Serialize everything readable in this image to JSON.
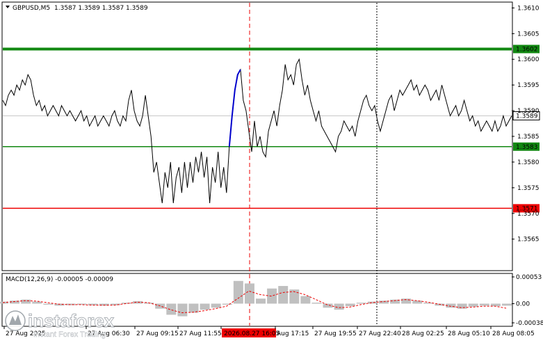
{
  "header": {
    "symbol": "GBPUSD,M5",
    "ohlc": "1.3587 1.3589 1.3587 1.3589"
  },
  "colors": {
    "price_line": "#000000",
    "highlight_line": "#0000cc",
    "level_green_thick": "#118811",
    "level_green": "#118811",
    "level_red": "#ee0000",
    "marker_red": "#ee0000",
    "macd_hist": "#c0c0c0",
    "macd_signal": "#ee0000",
    "tag_green": "#118811",
    "tag_red": "#ee0000",
    "tag_current_bg": "#ffffff"
  },
  "price_axis": {
    "ticks": [
      "1.3610",
      "1.3605",
      "1.3600",
      "1.3595",
      "1.3590",
      "1.3585",
      "1.3580",
      "1.3575",
      "1.3570",
      "1.3565"
    ]
  },
  "levels": [
    {
      "price": 1.3602,
      "label": "1.3602",
      "style": "thick-green"
    },
    {
      "price": 1.3583,
      "label": "1.3583",
      "style": "green"
    },
    {
      "price": 1.3571,
      "label": "1.3571",
      "style": "red"
    }
  ],
  "current_price": {
    "price": 1.3589,
    "label": "1.3589"
  },
  "macd": {
    "title": "MACD(12,26,9) -0.00005 -0.00009",
    "ticks": [
      "0.00053",
      "0.00",
      "-0.00038"
    ],
    "range": [
      -0.00038,
      0.00053
    ]
  },
  "time_axis": {
    "labels": [
      "27 Aug 2025",
      "27 Aug 06:30",
      "27 Aug 09:15",
      "27 Aug 11:55",
      "2026.08.27 16:05",
      "Aug 17:15",
      "27 Aug 19:55",
      "27 Aug 22:40",
      "28 Aug 02:25",
      "28 Aug 05:10",
      "28 Aug 08:05"
    ],
    "highlight_index": 4
  },
  "watermark": {
    "brand": "instaforex",
    "tagline": "Instant Forex Trading"
  },
  "chart_data": {
    "type": "line",
    "title": "GBPUSD,M5",
    "ylim": [
      1.3559,
      1.3611
    ],
    "series": [
      {
        "name": "GBPUSD,M5",
        "x": [
          0,
          1,
          2,
          3,
          4,
          5,
          6,
          7,
          8,
          9,
          10,
          11,
          12,
          13,
          14,
          15,
          16,
          17,
          18,
          19,
          20,
          21,
          22,
          23,
          24,
          25,
          26,
          27,
          28,
          29,
          30,
          31,
          32,
          33,
          34,
          35,
          36,
          37,
          38,
          39,
          40,
          41,
          42,
          43,
          44,
          45,
          46,
          47,
          48,
          49,
          50,
          51,
          52,
          53,
          54,
          55,
          56,
          57,
          58,
          59,
          60,
          61,
          62,
          63,
          64,
          65,
          66,
          67,
          68,
          69,
          70,
          71,
          72,
          73,
          74,
          75,
          76,
          77,
          78,
          79,
          80,
          81,
          82,
          83,
          84,
          85,
          86,
          87,
          88,
          89,
          90,
          91,
          92,
          93,
          94,
          95,
          96,
          97,
          98,
          99,
          100,
          101,
          102,
          103,
          104,
          105,
          106,
          107,
          108,
          109,
          110,
          111,
          112,
          113,
          114,
          115,
          116,
          117,
          118,
          119,
          120,
          121,
          122,
          123,
          124,
          125,
          126,
          127,
          128,
          129,
          130,
          131,
          132,
          133,
          134,
          135,
          136,
          137,
          138,
          139,
          140,
          141,
          142,
          143,
          144,
          145,
          146,
          147,
          148,
          149,
          150,
          151,
          152,
          153,
          154,
          155,
          156,
          157,
          158,
          159,
          160,
          161,
          162,
          163,
          164,
          165,
          166,
          167,
          168,
          169,
          170,
          171,
          172,
          173,
          174,
          175,
          176,
          177,
          178,
          179,
          180,
          181,
          182
        ],
        "values": [
          1.3592,
          1.3591,
          1.3593,
          1.3594,
          1.3593,
          1.3595,
          1.3594,
          1.3596,
          1.3595,
          1.3597,
          1.3596,
          1.3593,
          1.3591,
          1.3592,
          1.359,
          1.3591,
          1.3589,
          1.359,
          1.3591,
          1.359,
          1.3589,
          1.3591,
          1.359,
          1.3589,
          1.359,
          1.3589,
          1.3588,
          1.3589,
          1.359,
          1.3588,
          1.3589,
          1.3587,
          1.3588,
          1.3589,
          1.3587,
          1.3588,
          1.3589,
          1.3588,
          1.3587,
          1.3589,
          1.359,
          1.3588,
          1.3587,
          1.3589,
          1.3588,
          1.3592,
          1.3594,
          1.359,
          1.3588,
          1.3587,
          1.3589,
          1.3593,
          1.3589,
          1.3585,
          1.3578,
          1.358,
          1.3576,
          1.3572,
          1.3578,
          1.3575,
          1.358,
          1.3572,
          1.3577,
          1.3579,
          1.3574,
          1.358,
          1.3575,
          1.358,
          1.3576,
          1.3581,
          1.3578,
          1.3582,
          1.3577,
          1.3581,
          1.3572,
          1.3579,
          1.3576,
          1.3582,
          1.3575,
          1.3579,
          1.3574,
          1.3583,
          1.3589,
          1.3594,
          1.3597,
          1.3598,
          1.3592,
          1.359,
          1.3586,
          1.3582,
          1.3588,
          1.3583,
          1.3585,
          1.3582,
          1.3581,
          1.3586,
          1.3588,
          1.359,
          1.3587,
          1.3591,
          1.3594,
          1.3599,
          1.3596,
          1.3597,
          1.3595,
          1.3599,
          1.36,
          1.3596,
          1.3593,
          1.3595,
          1.3592,
          1.359,
          1.3588,
          1.359,
          1.3587,
          1.3586,
          1.3585,
          1.3584,
          1.3583,
          1.3582,
          1.3585,
          1.3586,
          1.3588,
          1.3587,
          1.3586,
          1.3587,
          1.3585,
          1.3588,
          1.359,
          1.3592,
          1.3593,
          1.3591,
          1.359,
          1.3591,
          1.3588,
          1.3586,
          1.3588,
          1.359,
          1.3592,
          1.3593,
          1.359,
          1.3592,
          1.3594,
          1.3593,
          1.3594,
          1.3595,
          1.3596,
          1.3594,
          1.3595,
          1.3593,
          1.3594,
          1.3595,
          1.3594,
          1.3592,
          1.3593,
          1.3594,
          1.3592,
          1.3595,
          1.3593,
          1.3591,
          1.3589,
          1.359,
          1.3591,
          1.3589,
          1.359,
          1.3592,
          1.359,
          1.3588,
          1.3589,
          1.3587,
          1.3588,
          1.3586,
          1.3587,
          1.3588,
          1.3587,
          1.3586,
          1.3588,
          1.3586,
          1.3587,
          1.3589,
          1.3587,
          1.3588,
          1.3589
        ]
      },
      {
        "name": "highlight",
        "x": [
          81,
          82,
          83,
          84,
          85
        ],
        "values": [
          1.3583,
          1.3589,
          1.3594,
          1.3597,
          1.3598
        ]
      },
      {
        "name": "MACD histogram",
        "x": [
          0,
          4,
          8,
          12,
          16,
          20,
          24,
          28,
          32,
          36,
          40,
          44,
          48,
          52,
          56,
          60,
          64,
          68,
          72,
          76,
          80,
          84,
          88,
          92,
          96,
          100,
          104,
          108,
          112,
          116,
          120,
          124,
          128,
          132,
          136,
          140,
          144,
          148,
          152,
          156,
          160,
          164,
          168,
          172,
          176,
          180
        ],
        "values": [
          4e-05,
          6e-05,
          8e-05,
          4e-05,
          -2e-05,
          -4e-05,
          -3e-05,
          -2e-05,
          -3e-05,
          -4e-05,
          -3e-05,
          2e-05,
          5e-05,
          2e-05,
          -0.0001,
          -0.00022,
          -0.00025,
          -0.00018,
          -0.00012,
          -8e-05,
          -2e-05,
          0.00045,
          0.0004,
          0.0001,
          0.0003,
          0.00035,
          0.00028,
          0.00015,
          2e-05,
          -8e-05,
          -0.00012,
          -5e-05,
          2e-05,
          4e-05,
          6e-05,
          8e-05,
          0.0001,
          6e-05,
          2e-05,
          -4e-05,
          -8e-05,
          -0.0001,
          -6e-05,
          -4e-05,
          -5e-05,
          -4e-05
        ]
      },
      {
        "name": "MACD signal",
        "x": [
          0,
          4,
          8,
          12,
          16,
          20,
          24,
          28,
          32,
          36,
          40,
          44,
          48,
          52,
          56,
          60,
          64,
          68,
          72,
          76,
          80,
          84,
          88,
          92,
          96,
          100,
          104,
          108,
          112,
          116,
          120,
          124,
          128,
          132,
          136,
          140,
          144,
          148,
          152,
          156,
          160,
          164,
          168,
          172,
          176,
          180
        ],
        "values": [
          2e-05,
          4e-05,
          6e-05,
          5e-05,
          2e-05,
          -1e-05,
          -2e-05,
          -2e-05,
          -3e-05,
          -3e-05,
          -3e-05,
          0.0,
          3e-05,
          2e-05,
          -4e-05,
          -0.00012,
          -0.00018,
          -0.00017,
          -0.00014,
          -0.0001,
          -5e-05,
          0.0001,
          0.00025,
          0.00018,
          0.00015,
          0.00022,
          0.00024,
          0.00018,
          8e-05,
          -2e-05,
          -8e-05,
          -7e-05,
          -2e-05,
          2e-05,
          4e-05,
          6e-05,
          8e-05,
          6e-05,
          3e-05,
          -1e-05,
          -5e-05,
          -8e-05,
          -7e-05,
          -5e-05,
          -5e-05,
          -9e-05
        ]
      }
    ]
  }
}
